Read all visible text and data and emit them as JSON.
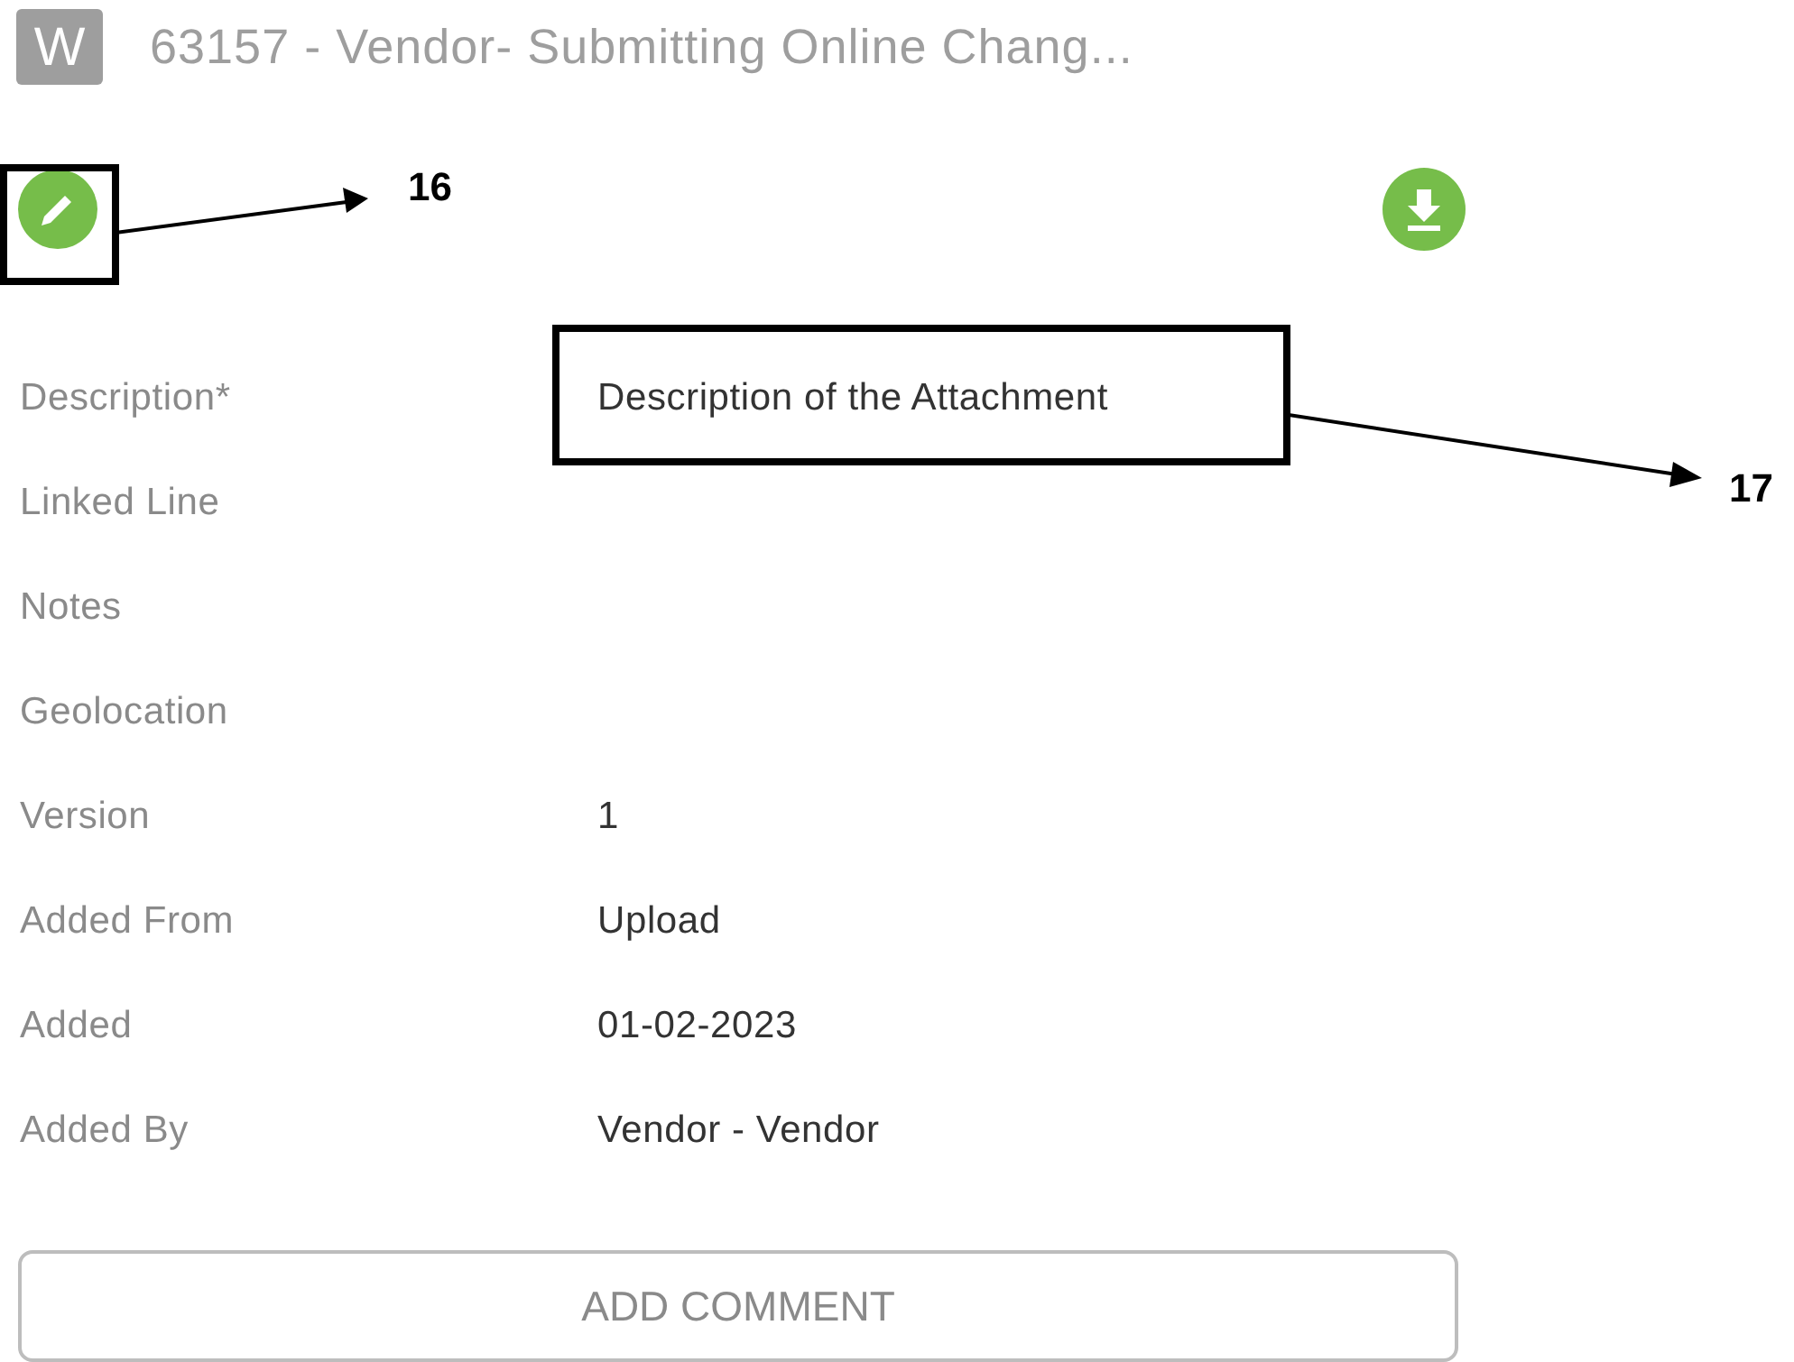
{
  "header": {
    "logo_letter": "W",
    "title": "63157 - Vendor- Submitting Online Chang..."
  },
  "fields": [
    {
      "label": "Description*",
      "value": "Description of the Attachment"
    },
    {
      "label": "Linked Line"
    },
    {
      "label": "Notes"
    },
    {
      "label": "Geolocation"
    },
    {
      "label": "Version",
      "value": "1"
    },
    {
      "label": "Added From",
      "value": "Upload"
    },
    {
      "label": "Added",
      "value": "01-02-2023"
    },
    {
      "label": "Added By",
      "value": "Vendor - Vendor"
    }
  ],
  "add_comment_button": "ADD COMMENT",
  "annotations": [
    {
      "label": "16"
    },
    {
      "label": "17"
    }
  ]
}
